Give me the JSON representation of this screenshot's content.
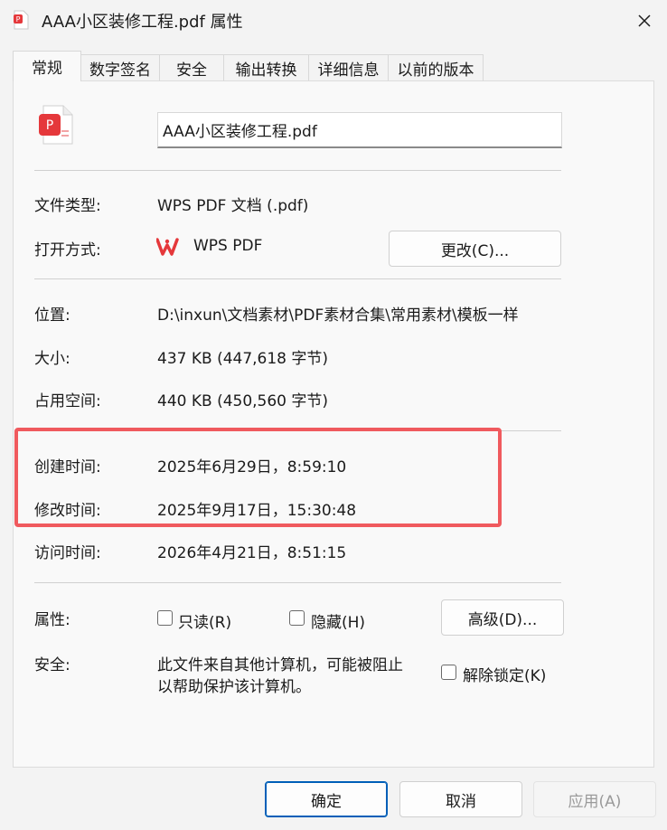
{
  "window": {
    "title": "AAA小区装修工程.pdf 属性",
    "close_label": "✕"
  },
  "tabs": [
    {
      "label": "常规",
      "active": true
    },
    {
      "label": "数字签名"
    },
    {
      "label": "安全"
    },
    {
      "label": "输出转换"
    },
    {
      "label": "详细信息"
    },
    {
      "label": "以前的版本"
    }
  ],
  "general": {
    "file_name": "AAA小区装修工程.pdf",
    "file_type_label": "文件类型:",
    "file_type_value": "WPS PDF 文档 (.pdf)",
    "open_with_label": "打开方式:",
    "open_with_value": "WPS PDF",
    "change_button": "更改(C)...",
    "location_label": "位置:",
    "location_value": "D:\\inxun\\文档素材\\PDF素材合集\\常用素材\\模板一样",
    "size_label": "大小:",
    "size_value": "437 KB (447,618 字节)",
    "disk_size_label": "占用空间:",
    "disk_size_value": "440 KB (450,560 字节)",
    "created_label": "创建时间:",
    "created_value": "2025年6月29日，8:59:10",
    "modified_label": "修改时间:",
    "modified_value": "2025年9月17日，15:30:48",
    "accessed_label": "访问时间:",
    "accessed_value": "2026年4月21日，8:51:15",
    "attributes_label": "属性:",
    "readonly_label": "只读(R)",
    "hidden_label": "隐藏(H)",
    "advanced_button": "高级(D)...",
    "security_label": "安全:",
    "security_text_line1": "此文件来自其他计算机，可能被阻止",
    "security_text_line2": "以帮助保护该计算机。",
    "unblock_label": "解除锁定(K)"
  },
  "footer": {
    "ok": "确定",
    "cancel": "取消",
    "apply": "应用(A)"
  },
  "colors": {
    "highlight": "#f05a5e",
    "pdf_icon": "#e5383b",
    "wps_logo": "#e5383b",
    "primary_border": "#005fb8"
  },
  "icons": {
    "title": "pdf-file-icon",
    "file": "pdf-file-icon",
    "open_with": "wps-logo-icon",
    "close": "close-icon"
  }
}
